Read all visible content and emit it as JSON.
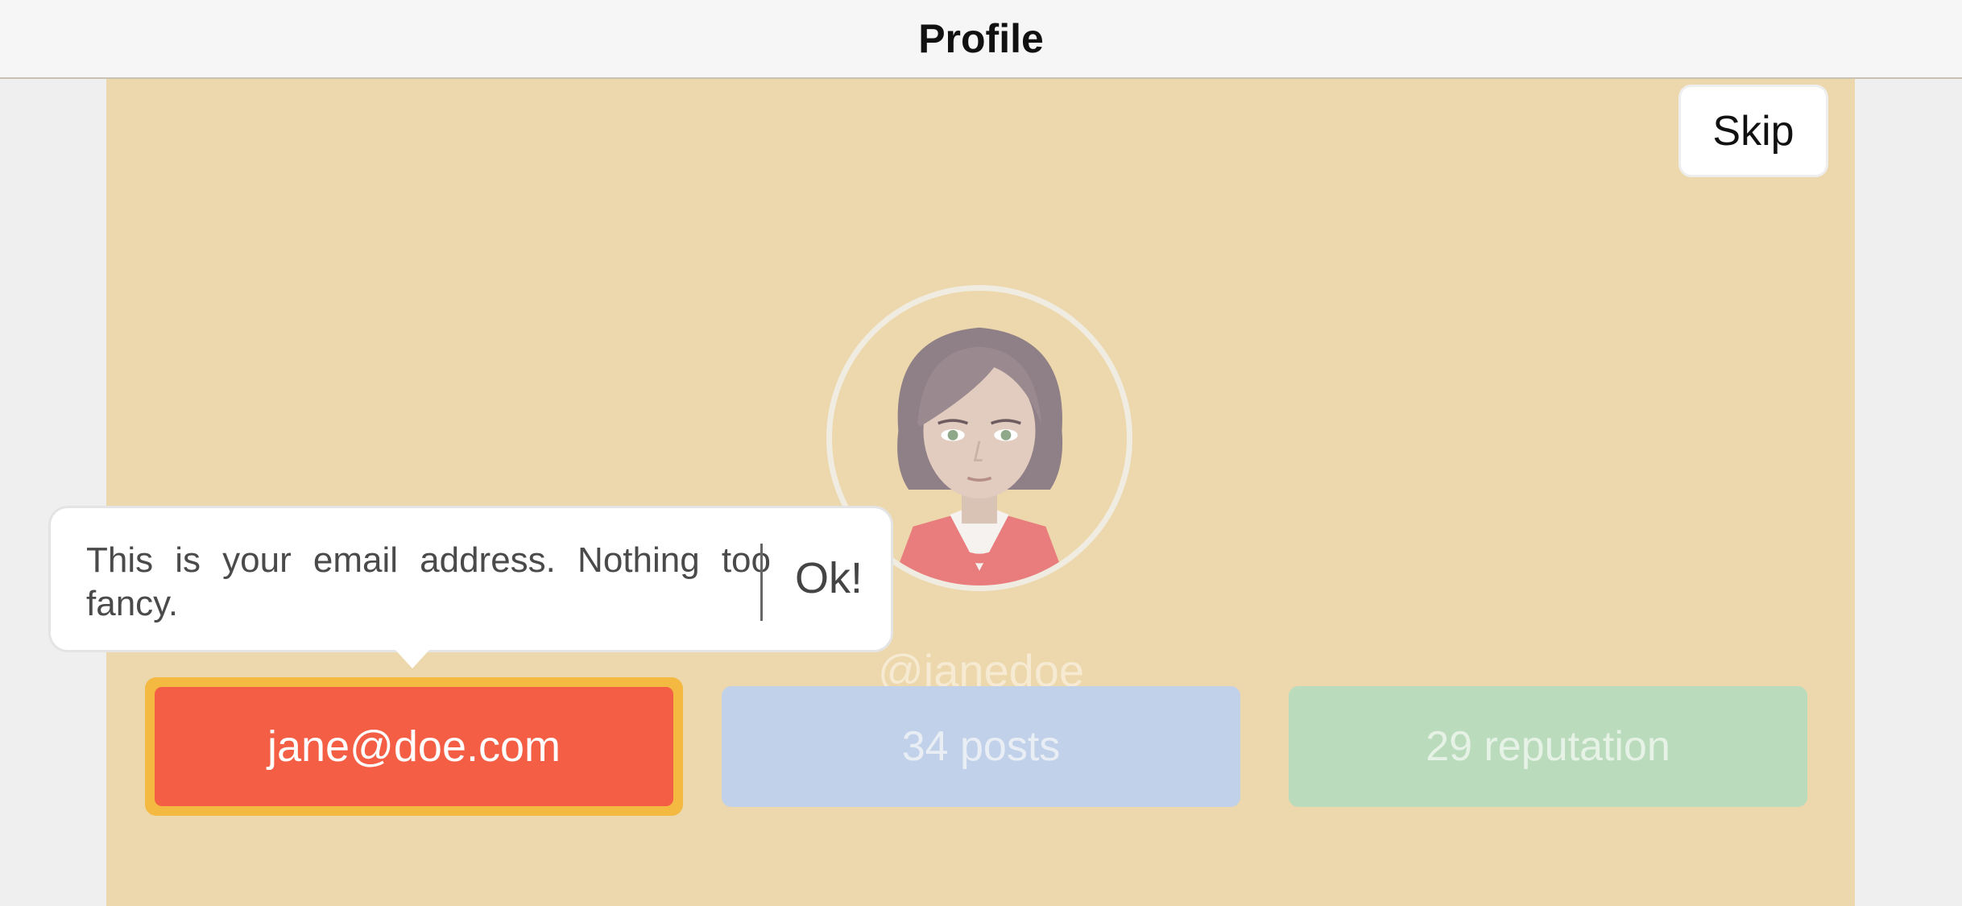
{
  "nav": {
    "title": "Profile"
  },
  "skip_label": "Skip",
  "profile": {
    "handle": "@janedoe"
  },
  "stats": {
    "email": "jane@doe.com",
    "posts": "34 posts",
    "reputation": "29 reputation"
  },
  "tooltip": {
    "message": "This is your email address. Nothing too fancy.",
    "ok_label": "Ok!"
  },
  "colors": {
    "background": "#ecd8ac",
    "email": "#f45e45",
    "email_highlight": "#f3b941",
    "posts": "#c2d1ea",
    "reputation": "#badcbd"
  }
}
